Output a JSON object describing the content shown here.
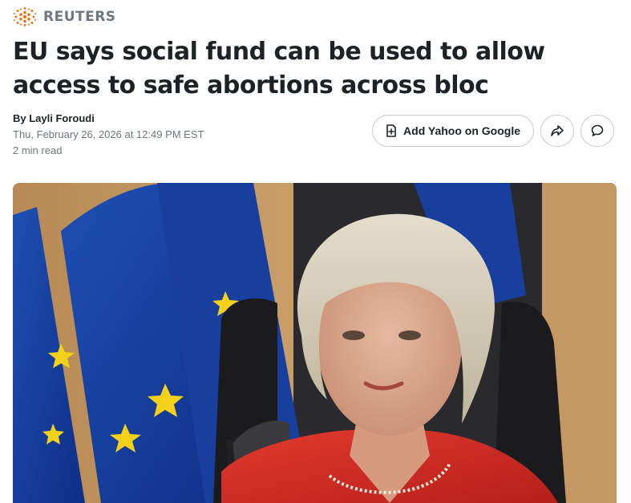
{
  "source": {
    "name": "REUTERS",
    "logo_icon": "reuters-dot-logo",
    "brand_color": "#fa6400"
  },
  "article": {
    "headline": "EU says social fund can be used to allow access to safe abortions across bloc",
    "author": "By Layli Foroudi",
    "timestamp": "Thu, February 26, 2026 at 12:49 PM EST",
    "read_time": "2 min read"
  },
  "actions": {
    "add_source_label": "Add Yahoo on Google",
    "add_source_icon": "add-document-icon",
    "share_icon": "share-arrow-icon",
    "comment_icon": "comment-bubble-icon"
  },
  "hero": {
    "description_icon": "photo"
  }
}
